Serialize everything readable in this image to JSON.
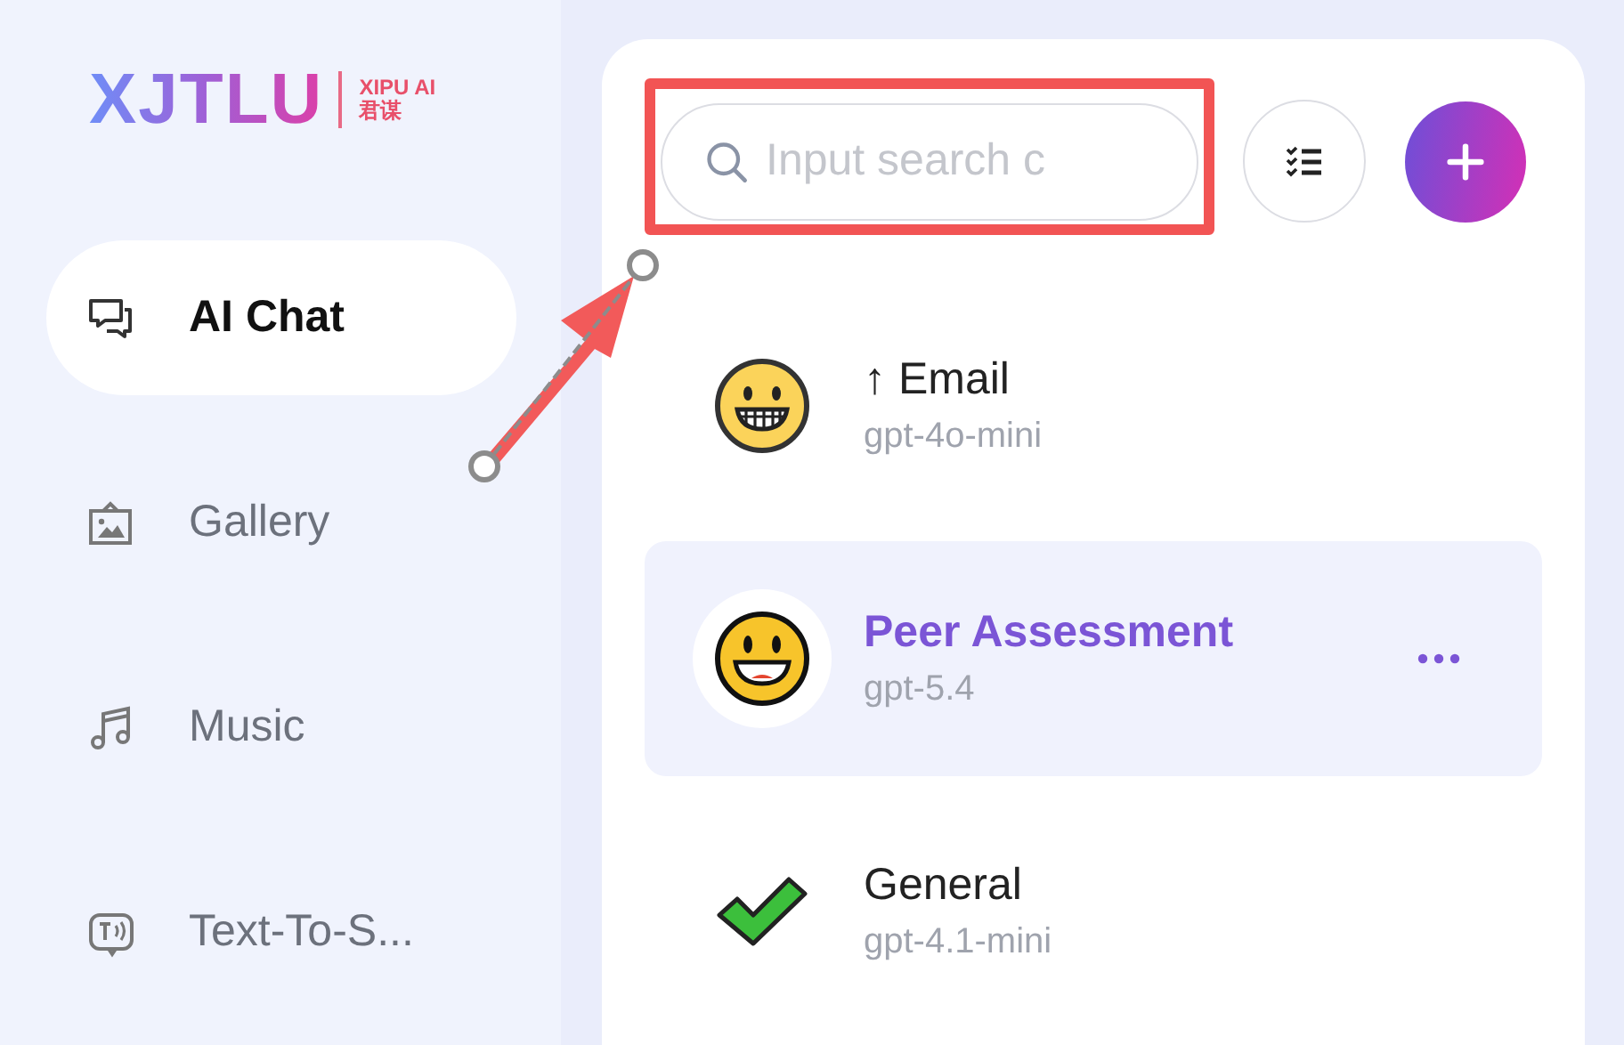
{
  "logo": {
    "wordmark": "XJTLU",
    "subtitle": "XIPU AI",
    "subtitle_cn": "君谋"
  },
  "sidebar": {
    "items": [
      {
        "label": "AI Chat",
        "kind": "chat",
        "selected": true
      },
      {
        "label": "Gallery",
        "kind": "gallery",
        "selected": false
      },
      {
        "label": "Music",
        "kind": "music",
        "selected": false
      },
      {
        "label": "Text-To-S...",
        "kind": "speech",
        "selected": false
      }
    ]
  },
  "search": {
    "placeholder": "Input search c"
  },
  "chats": [
    {
      "title": "↑ Email",
      "model": "gpt-4o-mini",
      "kind": "grin",
      "selected": false
    },
    {
      "title": "Peer Assessment",
      "model": "gpt-5.4",
      "kind": "smile",
      "selected": true
    },
    {
      "title": "General",
      "model": "gpt-4.1-mini",
      "kind": "check",
      "selected": false
    }
  ]
}
